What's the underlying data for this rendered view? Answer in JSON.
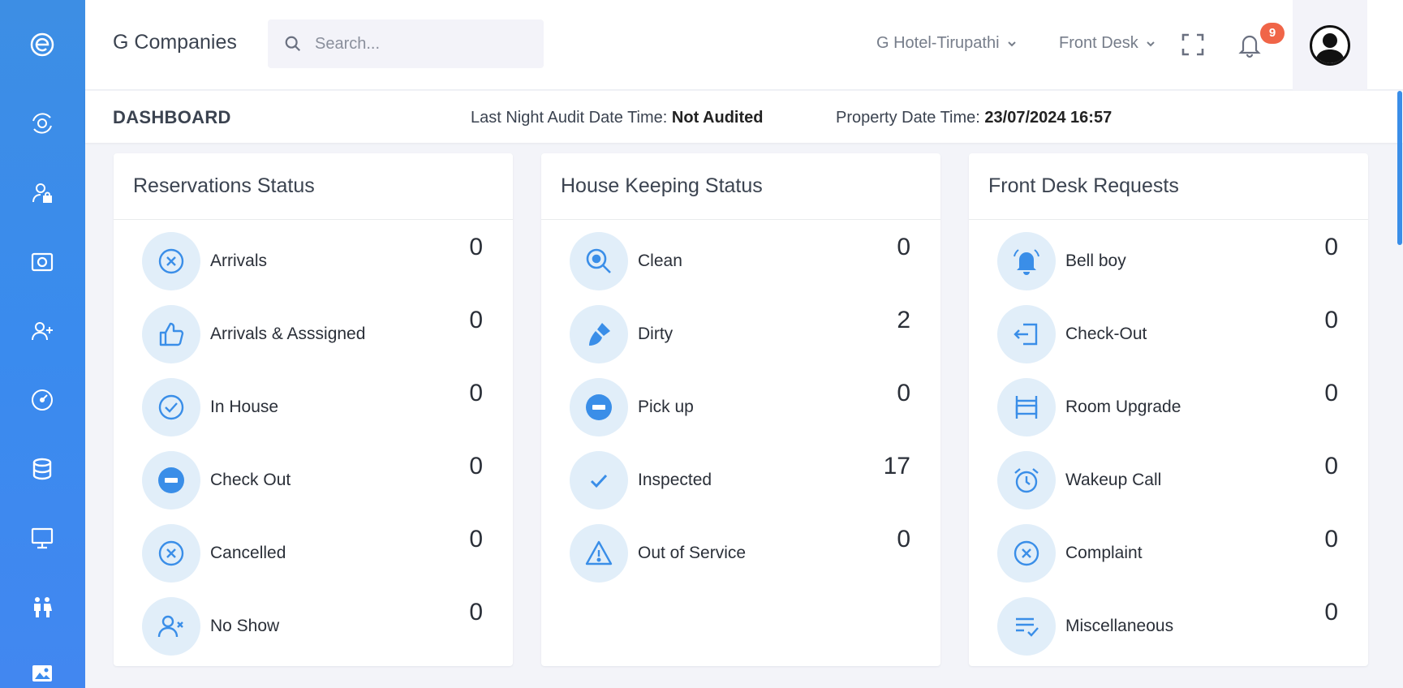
{
  "sidebar": {
    "items": [
      {
        "icon": "logo-e-icon"
      },
      {
        "icon": "eye-orbit-icon"
      },
      {
        "icon": "user-lock-icon"
      },
      {
        "icon": "camera-icon"
      },
      {
        "icon": "user-plus-icon"
      },
      {
        "icon": "dashboard-gauge-icon"
      },
      {
        "icon": "database-icon"
      },
      {
        "icon": "monitor-icon"
      },
      {
        "icon": "people-icon"
      },
      {
        "icon": "image-icon"
      }
    ]
  },
  "header": {
    "brand": "G Companies",
    "search_placeholder": "Search...",
    "hotel_select": "G Hotel-Tirupathi",
    "module_select": "Front Desk",
    "notification_count": "9"
  },
  "subheader": {
    "title": "DASHBOARD",
    "audit_label": "Last Night Audit Date Time:",
    "audit_value": "Not Audited",
    "property_label": "Property Date Time:",
    "property_value": "23/07/2024 16:57"
  },
  "colors": {
    "accent": "#3a8ee8",
    "icon_bg": "#e1eef9",
    "badge": "#f06548"
  },
  "cards": [
    {
      "title": "Reservations Status",
      "rows": [
        {
          "label": "Arrivals",
          "value": "0",
          "icon": "x-circle-icon"
        },
        {
          "label": "Arrivals & Asssigned",
          "value": "0",
          "icon": "thumbs-up-icon"
        },
        {
          "label": "In House",
          "value": "0",
          "icon": "check-circle-icon"
        },
        {
          "label": "Check Out",
          "value": "0",
          "icon": "minus-circle-icon"
        },
        {
          "label": "Cancelled",
          "value": "0",
          "icon": "x-circle-icon"
        },
        {
          "label": "No Show",
          "value": "0",
          "icon": "user-x-icon"
        }
      ]
    },
    {
      "title": "House Keeping Status",
      "rows": [
        {
          "label": "Clean",
          "value": "0",
          "icon": "search-eye-icon"
        },
        {
          "label": "Dirty",
          "value": "2",
          "icon": "brush-icon"
        },
        {
          "label": "Pick up",
          "value": "0",
          "icon": "minus-circle-icon"
        },
        {
          "label": "Inspected",
          "value": "17",
          "icon": "check-icon"
        },
        {
          "label": "Out of Service",
          "value": "0",
          "icon": "warning-icon"
        }
      ]
    },
    {
      "title": "Front Desk Requests",
      "rows": [
        {
          "label": "Bell boy",
          "value": "0",
          "icon": "bell-icon"
        },
        {
          "label": "Check-Out",
          "value": "0",
          "icon": "logout-icon"
        },
        {
          "label": "Room Upgrade",
          "value": "0",
          "icon": "bed-icon"
        },
        {
          "label": "Wakeup Call",
          "value": "0",
          "icon": "alarm-icon"
        },
        {
          "label": "Complaint",
          "value": "0",
          "icon": "x-circle-icon"
        },
        {
          "label": "Miscellaneous",
          "value": "0",
          "icon": "list-check-icon"
        }
      ]
    }
  ]
}
